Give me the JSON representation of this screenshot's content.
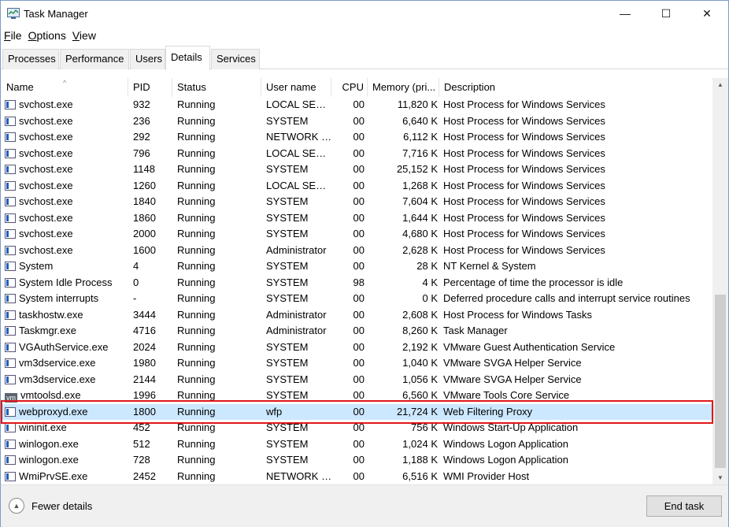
{
  "window": {
    "title": "Task Manager",
    "minimize_glyph": "—",
    "maximize_glyph": "☐",
    "close_glyph": "✕"
  },
  "menu": {
    "file_rest": "ile",
    "file_key": "F",
    "options_rest": "ptions",
    "options_key": "O",
    "view_rest": "iew",
    "view_key": "V"
  },
  "tabs": [
    "Processes",
    "Performance",
    "Users",
    "Details",
    "Services"
  ],
  "active_tab": "Details",
  "columns": {
    "name": "Name",
    "pid": "PID",
    "status": "Status",
    "user": "User name",
    "cpu": "CPU",
    "memory": "Memory (pri...",
    "description": "Description"
  },
  "sort_arrow": "^",
  "rows": [
    {
      "name": "svchost.exe",
      "pid": "932",
      "status": "Running",
      "user": "LOCAL SERV...",
      "cpu": "00",
      "mem": "11,820 K",
      "desc": "Host Process for Windows Services",
      "icon": "window"
    },
    {
      "name": "svchost.exe",
      "pid": "236",
      "status": "Running",
      "user": "SYSTEM",
      "cpu": "00",
      "mem": "6,640 K",
      "desc": "Host Process for Windows Services",
      "icon": "window"
    },
    {
      "name": "svchost.exe",
      "pid": "292",
      "status": "Running",
      "user": "NETWORK S...",
      "cpu": "00",
      "mem": "6,112 K",
      "desc": "Host Process for Windows Services",
      "icon": "window"
    },
    {
      "name": "svchost.exe",
      "pid": "796",
      "status": "Running",
      "user": "LOCAL SERV...",
      "cpu": "00",
      "mem": "7,716 K",
      "desc": "Host Process for Windows Services",
      "icon": "window"
    },
    {
      "name": "svchost.exe",
      "pid": "1148",
      "status": "Running",
      "user": "SYSTEM",
      "cpu": "00",
      "mem": "25,152 K",
      "desc": "Host Process for Windows Services",
      "icon": "window"
    },
    {
      "name": "svchost.exe",
      "pid": "1260",
      "status": "Running",
      "user": "LOCAL SERV...",
      "cpu": "00",
      "mem": "1,268 K",
      "desc": "Host Process for Windows Services",
      "icon": "window"
    },
    {
      "name": "svchost.exe",
      "pid": "1840",
      "status": "Running",
      "user": "SYSTEM",
      "cpu": "00",
      "mem": "7,604 K",
      "desc": "Host Process for Windows Services",
      "icon": "window"
    },
    {
      "name": "svchost.exe",
      "pid": "1860",
      "status": "Running",
      "user": "SYSTEM",
      "cpu": "00",
      "mem": "1,644 K",
      "desc": "Host Process for Windows Services",
      "icon": "window"
    },
    {
      "name": "svchost.exe",
      "pid": "2000",
      "status": "Running",
      "user": "SYSTEM",
      "cpu": "00",
      "mem": "4,680 K",
      "desc": "Host Process for Windows Services",
      "icon": "window"
    },
    {
      "name": "svchost.exe",
      "pid": "1600",
      "status": "Running",
      "user": "Administrator",
      "cpu": "00",
      "mem": "2,628 K",
      "desc": "Host Process for Windows Services",
      "icon": "window"
    },
    {
      "name": "System",
      "pid": "4",
      "status": "Running",
      "user": "SYSTEM",
      "cpu": "00",
      "mem": "28 K",
      "desc": "NT Kernel & System",
      "icon": "window"
    },
    {
      "name": "System Idle Process",
      "pid": "0",
      "status": "Running",
      "user": "SYSTEM",
      "cpu": "98",
      "mem": "4 K",
      "desc": "Percentage of time the processor is idle",
      "icon": "window"
    },
    {
      "name": "System interrupts",
      "pid": "-",
      "status": "Running",
      "user": "SYSTEM",
      "cpu": "00",
      "mem": "0 K",
      "desc": "Deferred procedure calls and interrupt service routines",
      "icon": "window"
    },
    {
      "name": "taskhostw.exe",
      "pid": "3444",
      "status": "Running",
      "user": "Administrator",
      "cpu": "00",
      "mem": "2,608 K",
      "desc": "Host Process for Windows Tasks",
      "icon": "window"
    },
    {
      "name": "Taskmgr.exe",
      "pid": "4716",
      "status": "Running",
      "user": "Administrator",
      "cpu": "00",
      "mem": "8,260 K",
      "desc": "Task Manager",
      "icon": "window"
    },
    {
      "name": "VGAuthService.exe",
      "pid": "2024",
      "status": "Running",
      "user": "SYSTEM",
      "cpu": "00",
      "mem": "2,192 K",
      "desc": "VMware Guest Authentication Service",
      "icon": "window"
    },
    {
      "name": "vm3dservice.exe",
      "pid": "1980",
      "status": "Running",
      "user": "SYSTEM",
      "cpu": "00",
      "mem": "1,040 K",
      "desc": "VMware SVGA Helper Service",
      "icon": "window"
    },
    {
      "name": "vm3dservice.exe",
      "pid": "2144",
      "status": "Running",
      "user": "SYSTEM",
      "cpu": "00",
      "mem": "1,056 K",
      "desc": "VMware SVGA Helper Service",
      "icon": "window"
    },
    {
      "name": "vmtoolsd.exe",
      "pid": "1996",
      "status": "Running",
      "user": "SYSTEM",
      "cpu": "00",
      "mem": "6,560 K",
      "desc": "VMware Tools Core Service",
      "icon": "vm"
    },
    {
      "name": "webproxyd.exe",
      "pid": "1800",
      "status": "Running",
      "user": "wfp",
      "cpu": "00",
      "mem": "21,724 K",
      "desc": "Web Filtering Proxy",
      "icon": "window",
      "selected": true
    },
    {
      "name": "wininit.exe",
      "pid": "452",
      "status": "Running",
      "user": "SYSTEM",
      "cpu": "00",
      "mem": "756 K",
      "desc": "Windows Start-Up Application",
      "icon": "window"
    },
    {
      "name": "winlogon.exe",
      "pid": "512",
      "status": "Running",
      "user": "SYSTEM",
      "cpu": "00",
      "mem": "1,024 K",
      "desc": "Windows Logon Application",
      "icon": "window"
    },
    {
      "name": "winlogon.exe",
      "pid": "728",
      "status": "Running",
      "user": "SYSTEM",
      "cpu": "00",
      "mem": "1,188 K",
      "desc": "Windows Logon Application",
      "icon": "window"
    },
    {
      "name": "WmiPrvSE.exe",
      "pid": "2452",
      "status": "Running",
      "user": "NETWORK S...",
      "cpu": "00",
      "mem": "6,516 K",
      "desc": "WMI Provider Host",
      "icon": "window"
    }
  ],
  "scrollbar": {
    "up": "▲",
    "down": "▼"
  },
  "vm_icon_text": "vm",
  "footer": {
    "fewer_details": "Fewer details",
    "fewer_icon": "▲",
    "end_task": "End task"
  },
  "colors": {
    "selected_row": "#cce8ff",
    "highlight_border": "#e0161b"
  }
}
